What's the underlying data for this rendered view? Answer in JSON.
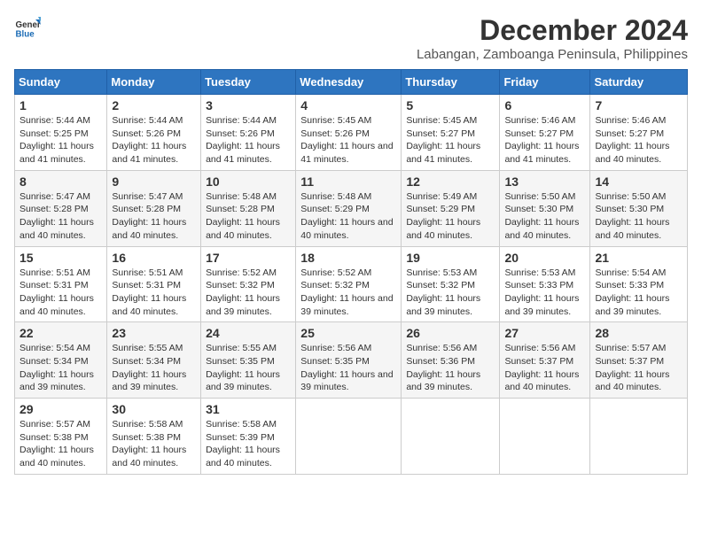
{
  "logo": {
    "line1": "General",
    "line2": "Blue",
    "icon_color": "#1a6bb5"
  },
  "title": "December 2024",
  "subtitle": "Labangan, Zamboanga Peninsula, Philippines",
  "weekdays": [
    "Sunday",
    "Monday",
    "Tuesday",
    "Wednesday",
    "Thursday",
    "Friday",
    "Saturday"
  ],
  "weeks": [
    [
      {
        "day": "1",
        "sunrise": "5:44 AM",
        "sunset": "5:25 PM",
        "daylight": "11 hours and 41 minutes."
      },
      {
        "day": "2",
        "sunrise": "5:44 AM",
        "sunset": "5:26 PM",
        "daylight": "11 hours and 41 minutes."
      },
      {
        "day": "3",
        "sunrise": "5:44 AM",
        "sunset": "5:26 PM",
        "daylight": "11 hours and 41 minutes."
      },
      {
        "day": "4",
        "sunrise": "5:45 AM",
        "sunset": "5:26 PM",
        "daylight": "11 hours and 41 minutes."
      },
      {
        "day": "5",
        "sunrise": "5:45 AM",
        "sunset": "5:27 PM",
        "daylight": "11 hours and 41 minutes."
      },
      {
        "day": "6",
        "sunrise": "5:46 AM",
        "sunset": "5:27 PM",
        "daylight": "11 hours and 41 minutes."
      },
      {
        "day": "7",
        "sunrise": "5:46 AM",
        "sunset": "5:27 PM",
        "daylight": "11 hours and 40 minutes."
      }
    ],
    [
      {
        "day": "8",
        "sunrise": "5:47 AM",
        "sunset": "5:28 PM",
        "daylight": "11 hours and 40 minutes."
      },
      {
        "day": "9",
        "sunrise": "5:47 AM",
        "sunset": "5:28 PM",
        "daylight": "11 hours and 40 minutes."
      },
      {
        "day": "10",
        "sunrise": "5:48 AM",
        "sunset": "5:28 PM",
        "daylight": "11 hours and 40 minutes."
      },
      {
        "day": "11",
        "sunrise": "5:48 AM",
        "sunset": "5:29 PM",
        "daylight": "11 hours and 40 minutes."
      },
      {
        "day": "12",
        "sunrise": "5:49 AM",
        "sunset": "5:29 PM",
        "daylight": "11 hours and 40 minutes."
      },
      {
        "day": "13",
        "sunrise": "5:50 AM",
        "sunset": "5:30 PM",
        "daylight": "11 hours and 40 minutes."
      },
      {
        "day": "14",
        "sunrise": "5:50 AM",
        "sunset": "5:30 PM",
        "daylight": "11 hours and 40 minutes."
      }
    ],
    [
      {
        "day": "15",
        "sunrise": "5:51 AM",
        "sunset": "5:31 PM",
        "daylight": "11 hours and 40 minutes."
      },
      {
        "day": "16",
        "sunrise": "5:51 AM",
        "sunset": "5:31 PM",
        "daylight": "11 hours and 40 minutes."
      },
      {
        "day": "17",
        "sunrise": "5:52 AM",
        "sunset": "5:32 PM",
        "daylight": "11 hours and 39 minutes."
      },
      {
        "day": "18",
        "sunrise": "5:52 AM",
        "sunset": "5:32 PM",
        "daylight": "11 hours and 39 minutes."
      },
      {
        "day": "19",
        "sunrise": "5:53 AM",
        "sunset": "5:32 PM",
        "daylight": "11 hours and 39 minutes."
      },
      {
        "day": "20",
        "sunrise": "5:53 AM",
        "sunset": "5:33 PM",
        "daylight": "11 hours and 39 minutes."
      },
      {
        "day": "21",
        "sunrise": "5:54 AM",
        "sunset": "5:33 PM",
        "daylight": "11 hours and 39 minutes."
      }
    ],
    [
      {
        "day": "22",
        "sunrise": "5:54 AM",
        "sunset": "5:34 PM",
        "daylight": "11 hours and 39 minutes."
      },
      {
        "day": "23",
        "sunrise": "5:55 AM",
        "sunset": "5:34 PM",
        "daylight": "11 hours and 39 minutes."
      },
      {
        "day": "24",
        "sunrise": "5:55 AM",
        "sunset": "5:35 PM",
        "daylight": "11 hours and 39 minutes."
      },
      {
        "day": "25",
        "sunrise": "5:56 AM",
        "sunset": "5:35 PM",
        "daylight": "11 hours and 39 minutes."
      },
      {
        "day": "26",
        "sunrise": "5:56 AM",
        "sunset": "5:36 PM",
        "daylight": "11 hours and 39 minutes."
      },
      {
        "day": "27",
        "sunrise": "5:56 AM",
        "sunset": "5:37 PM",
        "daylight": "11 hours and 40 minutes."
      },
      {
        "day": "28",
        "sunrise": "5:57 AM",
        "sunset": "5:37 PM",
        "daylight": "11 hours and 40 minutes."
      }
    ],
    [
      {
        "day": "29",
        "sunrise": "5:57 AM",
        "sunset": "5:38 PM",
        "daylight": "11 hours and 40 minutes."
      },
      {
        "day": "30",
        "sunrise": "5:58 AM",
        "sunset": "5:38 PM",
        "daylight": "11 hours and 40 minutes."
      },
      {
        "day": "31",
        "sunrise": "5:58 AM",
        "sunset": "5:39 PM",
        "daylight": "11 hours and 40 minutes."
      },
      null,
      null,
      null,
      null
    ]
  ]
}
